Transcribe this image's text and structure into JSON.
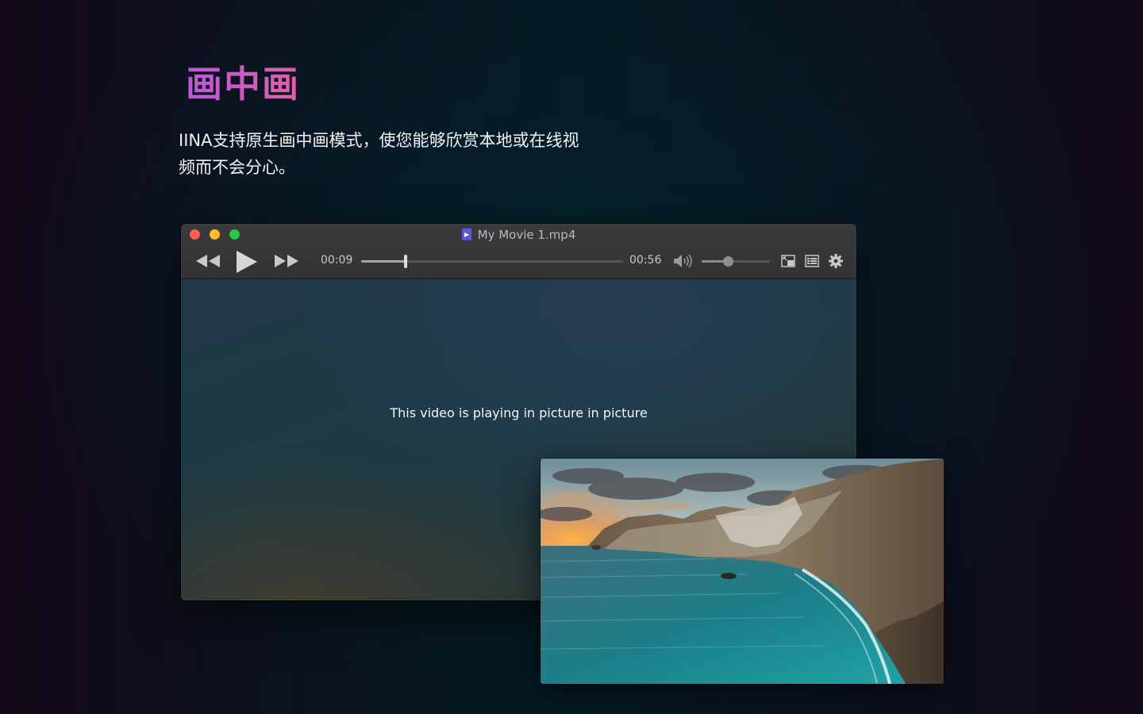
{
  "page": {
    "heading": "画中画",
    "description": "IINA支持原生画中画模式，使您能够欣赏本地或在线视频而不会分心。"
  },
  "player": {
    "title": "My Movie 1.mp4",
    "current_time": "00:09",
    "duration": "00:56",
    "progress_fraction": 0.17,
    "volume_fraction": 0.38,
    "pip_message": "This video is playing in picture in picture"
  },
  "icons": {
    "file": "video-file-icon",
    "rewind": "rewind-icon",
    "play": "play-icon",
    "fast_forward": "fast-forward-icon",
    "volume": "volume-icon",
    "pip": "picture-in-picture-icon",
    "playlist": "playlist-icon",
    "settings": "gear-icon"
  },
  "colors": {
    "heading_gradient_start": "#b95ad6",
    "heading_gradient_end": "#e35ea8",
    "close": "#fe5f57",
    "minimize": "#febc2e",
    "maximize": "#28c840",
    "file_icon": "#5b57e0"
  }
}
